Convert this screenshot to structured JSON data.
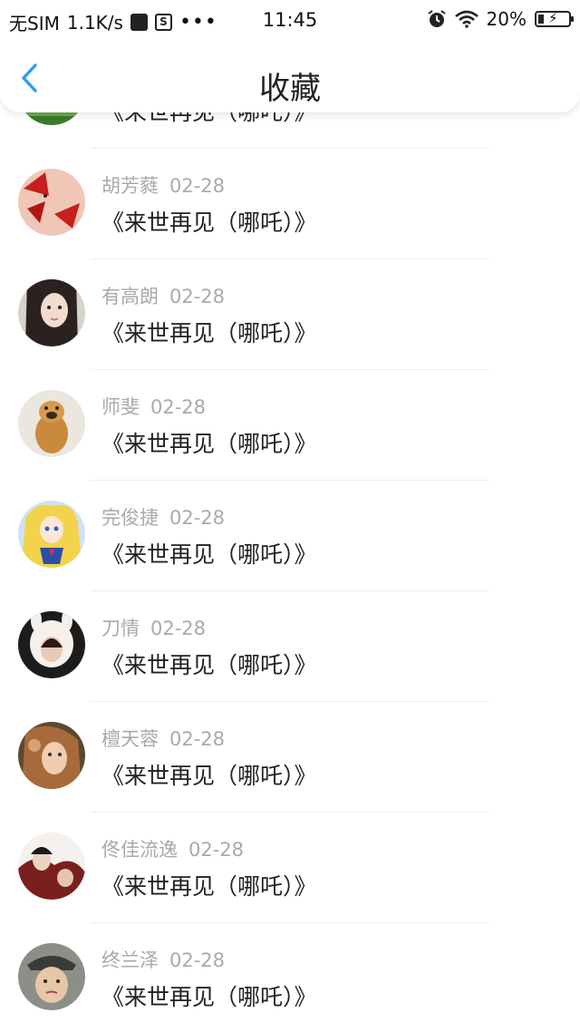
{
  "status_bar": {
    "carrier": "无SIM",
    "speed": "1.1K/s",
    "time": "11:45",
    "battery": "20%",
    "icons": [
      "bag-icon",
      "s-icon",
      "more-dots-icon",
      "alarm-icon",
      "wifi-icon",
      "battery-icon"
    ]
  },
  "nav": {
    "back_icon": "chevron-left-icon",
    "title": "收藏",
    "accent": "#2b9cf2"
  },
  "items": [
    {
      "name": "",
      "date": "",
      "title": "《来世再见（哪吒）》"
    },
    {
      "name": "胡芳蕤",
      "date": "02-28",
      "title": "《来世再见（哪吒）》"
    },
    {
      "name": "有高朗",
      "date": "02-28",
      "title": "《来世再见（哪吒）》"
    },
    {
      "name": "师斐",
      "date": "02-28",
      "title": "《来世再见（哪吒）》"
    },
    {
      "name": "完俊捷",
      "date": "02-28",
      "title": "《来世再见（哪吒）》"
    },
    {
      "name": "刀情",
      "date": "02-28",
      "title": "《来世再见（哪吒）》"
    },
    {
      "name": "檀天蓉",
      "date": "02-28",
      "title": "《来世再见（哪吒）》"
    },
    {
      "name": "佟佳流逸",
      "date": "02-28",
      "title": "《来世再见（哪吒）》"
    },
    {
      "name": "终兰泽",
      "date": "02-28",
      "title": "《来世再见（哪吒）》"
    }
  ]
}
